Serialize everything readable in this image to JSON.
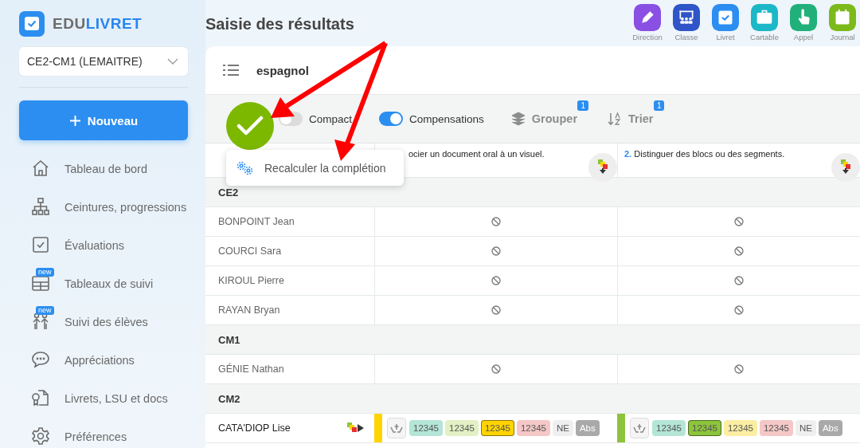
{
  "sidebar": {
    "logo": {
      "prefix": "EDU",
      "suffix": "LIVRET"
    },
    "class_select": {
      "value": "CE2-CM1 (LEMAITRE)"
    },
    "new_button": {
      "label": "Nouveau"
    },
    "nav": [
      {
        "label": "Tableau de bord"
      },
      {
        "label": "Ceintures, progressions"
      },
      {
        "label": "Évaluations"
      },
      {
        "label": "Tableaux de suivi",
        "badge": "new"
      },
      {
        "label": "Suivi des élèves",
        "badge": "new"
      },
      {
        "label": "Appréciations"
      },
      {
        "label": "Livrets, LSU et docs"
      },
      {
        "label": "Préférences"
      }
    ]
  },
  "page_title": "Saisie des résultats",
  "apps": [
    {
      "label": "Direction",
      "color": "#8a4fe3"
    },
    {
      "label": "Classe",
      "color": "#2f55c8"
    },
    {
      "label": "Livret",
      "color": "#2b8ef0"
    },
    {
      "label": "Cartable",
      "color": "#1cb8c8"
    },
    {
      "label": "Appel",
      "color": "#22b07a"
    },
    {
      "label": "Journal",
      "color": "#7cba1c"
    }
  ],
  "subject": "espagnol",
  "toolbar": {
    "toggles": [
      {
        "label": "Compact",
        "on": false
      },
      {
        "label": "Compensations",
        "on": true
      }
    ],
    "actions": [
      {
        "label": "Grouper",
        "badge": "1"
      },
      {
        "label": "Trier",
        "badge": "1"
      }
    ]
  },
  "completion_menu": {
    "items": [
      {
        "label": "Recalculer la complétion"
      }
    ]
  },
  "columns": [
    {
      "title": "ocier un document oral à un visuel."
    },
    {
      "number": "2.",
      "title": "Distinguer des blocs ou des segments."
    }
  ],
  "groups": [
    {
      "label": "CE2",
      "students": [
        {
          "name": "BONPOINT Jean",
          "cells": [
            {
              "kind": "empty"
            },
            {
              "kind": "empty"
            }
          ]
        },
        {
          "name": "COURCI Sara",
          "cells": [
            {
              "kind": "empty"
            },
            {
              "kind": "empty"
            }
          ]
        },
        {
          "name": "KIROUL Pierre",
          "cells": [
            {
              "kind": "empty"
            },
            {
              "kind": "empty"
            }
          ]
        },
        {
          "name": "RAYAN Bryan",
          "cells": [
            {
              "kind": "empty"
            },
            {
              "kind": "empty"
            }
          ]
        }
      ]
    },
    {
      "label": "CM1",
      "students": [
        {
          "name": "GÉNIE Nathan",
          "cells": [
            {
              "kind": "empty"
            },
            {
              "kind": "empty"
            }
          ]
        }
      ]
    },
    {
      "label": "CM2",
      "students": [
        {
          "name": "CATA'DIOP Lise",
          "cells": [
            {
              "kind": "grades",
              "color": "#ffd400",
              "chips": [
                {
                  "label": "12345",
                  "color": "#b4e5d7",
                  "selected": false
                },
                {
                  "label": "12345",
                  "color": "#e3f0c4",
                  "selected": false
                },
                {
                  "label": "12345",
                  "color": "#ffd400",
                  "selected": true
                },
                {
                  "label": "12345",
                  "color": "#f5c7c7",
                  "selected": false
                },
                {
                  "label": "NE",
                  "color": "#efefef",
                  "selected": false
                },
                {
                  "label": "Abs",
                  "color": "#a9a9a9",
                  "selected": false
                }
              ]
            },
            {
              "kind": "grades",
              "color": "#8cc43c",
              "chips": [
                {
                  "label": "12345",
                  "color": "#b4e5d7",
                  "selected": false
                },
                {
                  "label": "12345",
                  "color": "#8cc43c",
                  "selected": true
                },
                {
                  "label": "12345",
                  "color": "#fbeea2",
                  "selected": false
                },
                {
                  "label": "12345",
                  "color": "#f5c7c7",
                  "selected": false
                },
                {
                  "label": "NE",
                  "color": "#efefef",
                  "selected": false
                },
                {
                  "label": "Abs",
                  "color": "#a9a9a9",
                  "selected": false
                }
              ]
            }
          ]
        }
      ]
    }
  ]
}
